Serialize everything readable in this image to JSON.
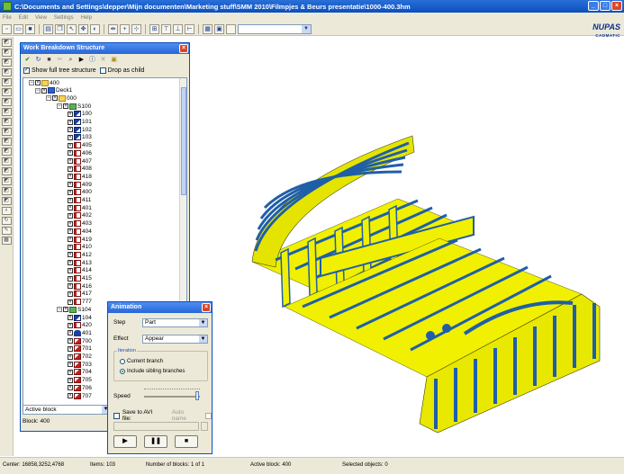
{
  "window": {
    "title": "C:\\Documents and Settings\\depper\\Mijn documenten\\Marketing stuff\\SMM 2010\\Filmpjes & Beurs presentatie\\1000-400.3hm",
    "min_label": "_",
    "max_label": "□",
    "close_label": "×"
  },
  "menu": [
    "File",
    "Edit",
    "View",
    "Settings",
    "Help"
  ],
  "logo": {
    "name": "NUPAS",
    "sub": "CADMATIC"
  },
  "wbs": {
    "title": "Work Breakdown Structure",
    "close_label": "×",
    "show_full_tree_label": "Show full tree structure",
    "show_full_tree_checked": "✓",
    "drop_as_child_label": "Drop as child",
    "active_combo": "Active block",
    "status": "Block: 400",
    "tree": [
      {
        "label": "400",
        "depth": 0,
        "icon": "folder",
        "exp": "−"
      },
      {
        "label": "Deck1",
        "depth": 1,
        "icon": "deck",
        "exp": "−"
      },
      {
        "label": "000",
        "depth": 2,
        "icon": "folder",
        "exp": "−"
      },
      {
        "label": "S100",
        "depth": 3,
        "icon": "ship",
        "exp": "−"
      },
      {
        "label": "100",
        "depth": 4,
        "icon": "part-blue"
      },
      {
        "label": "101",
        "depth": 4,
        "icon": "part-blue"
      },
      {
        "label": "102",
        "depth": 4,
        "icon": "part-blue"
      },
      {
        "label": "103",
        "depth": 4,
        "icon": "part-blue"
      },
      {
        "label": "405",
        "depth": 4,
        "icon": "part-red"
      },
      {
        "label": "406",
        "depth": 4,
        "icon": "part-red"
      },
      {
        "label": "407",
        "depth": 4,
        "icon": "part-red"
      },
      {
        "label": "408",
        "depth": 4,
        "icon": "part-red"
      },
      {
        "label": "418",
        "depth": 4,
        "icon": "part-red"
      },
      {
        "label": "409",
        "depth": 4,
        "icon": "part-red"
      },
      {
        "label": "400",
        "depth": 4,
        "icon": "part-red"
      },
      {
        "label": "411",
        "depth": 4,
        "icon": "part-red"
      },
      {
        "label": "401",
        "depth": 4,
        "icon": "part-red"
      },
      {
        "label": "402",
        "depth": 4,
        "icon": "part-red"
      },
      {
        "label": "403",
        "depth": 4,
        "icon": "part-red"
      },
      {
        "label": "404",
        "depth": 4,
        "icon": "part-red"
      },
      {
        "label": "419",
        "depth": 4,
        "icon": "part-red"
      },
      {
        "label": "410",
        "depth": 4,
        "icon": "part-red"
      },
      {
        "label": "412",
        "depth": 4,
        "icon": "part-red"
      },
      {
        "label": "413",
        "depth": 4,
        "icon": "part-red"
      },
      {
        "label": "414",
        "depth": 4,
        "icon": "part-red"
      },
      {
        "label": "415",
        "depth": 4,
        "icon": "part-red"
      },
      {
        "label": "416",
        "depth": 4,
        "icon": "part-red"
      },
      {
        "label": "417",
        "depth": 4,
        "icon": "part-red"
      },
      {
        "label": "777",
        "depth": 4,
        "icon": "part-red"
      },
      {
        "label": "S104",
        "depth": 3,
        "icon": "ship",
        "exp": "−"
      },
      {
        "label": "104",
        "depth": 4,
        "icon": "part-blue"
      },
      {
        "label": "420",
        "depth": 4,
        "icon": "part-red"
      },
      {
        "label": "401",
        "depth": 4,
        "icon": "part-arch"
      },
      {
        "label": "700",
        "depth": 4,
        "icon": "part-tri"
      },
      {
        "label": "701",
        "depth": 4,
        "icon": "part-tri"
      },
      {
        "label": "702",
        "depth": 4,
        "icon": "part-tri"
      },
      {
        "label": "703",
        "depth": 4,
        "icon": "part-tri"
      },
      {
        "label": "704",
        "depth": 4,
        "icon": "part-tri"
      },
      {
        "label": "705",
        "depth": 4,
        "icon": "part-tri"
      },
      {
        "label": "706",
        "depth": 4,
        "icon": "part-tri"
      },
      {
        "label": "707",
        "depth": 4,
        "icon": "part-tri"
      }
    ]
  },
  "animation": {
    "title": "Animation",
    "close_label": "×",
    "step_label": "Step",
    "step_value": "Part",
    "effect_label": "Effect",
    "effect_value": "Appear",
    "iteration_legend": "Iteration",
    "current_branch": "Current branch",
    "include_sibling": "Include sibling branches",
    "selected_iteration": "Include sibling branches",
    "speed_label": "Speed",
    "speed_level": 0.95,
    "save_avi_label": "Save to AVI file:",
    "auto_name_label": "Auto name",
    "play_label": "▶",
    "pause_label": "❚❚",
    "stop_label": "■"
  },
  "status": {
    "center": "Center: 16858,3252,4768",
    "items": "Items: 103",
    "blocks": "Number of blocks: 1 of 1",
    "active_block": "Active block: 400",
    "selected": "Selected objects: 0"
  },
  "colors": {
    "accent": "#0a4fbd",
    "structure_yellow": "#f0f000",
    "structure_blue": "#1f5fa8"
  }
}
